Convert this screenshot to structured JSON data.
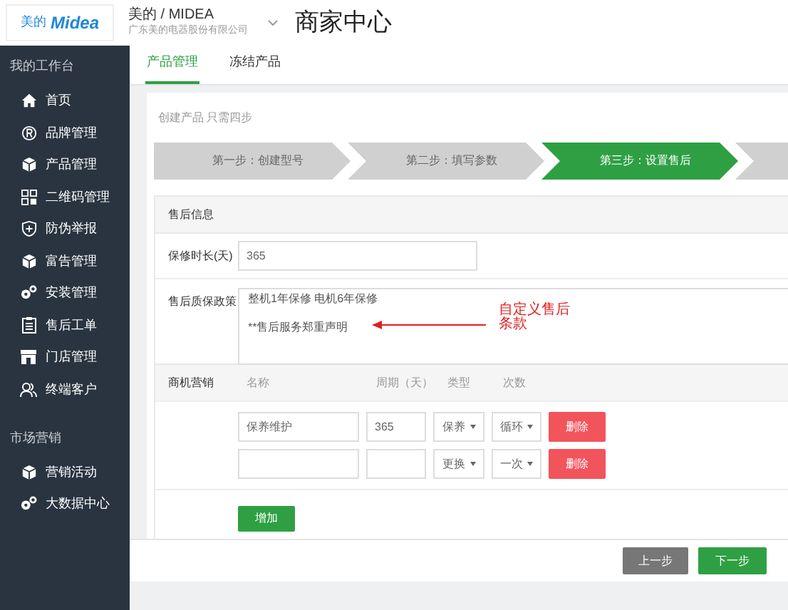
{
  "header": {
    "logo_cn": "美的",
    "logo": "Midea",
    "brand": "美的 / MIDEA",
    "company": "广东美的电器股份有限公司",
    "title": "商家中心"
  },
  "sidebar": {
    "sections": [
      {
        "title": "我的工作台",
        "items": [
          {
            "label": "首页"
          },
          {
            "label": "品牌管理"
          },
          {
            "label": "产品管理"
          },
          {
            "label": "二维码管理"
          },
          {
            "label": "防伪举报"
          },
          {
            "label": "富告管理"
          },
          {
            "label": "安装管理"
          },
          {
            "label": "售后工单"
          },
          {
            "label": "门店管理"
          },
          {
            "label": "终端客户"
          }
        ]
      },
      {
        "title": "市场营销",
        "items": [
          {
            "label": "营销活动"
          },
          {
            "label": "大数据中心"
          }
        ]
      }
    ]
  },
  "tabs": [
    {
      "label": "产品管理",
      "selected": true
    },
    {
      "label": "冻结产品",
      "selected": false
    }
  ],
  "intro": "创建产品 只需四步",
  "steps": [
    {
      "label": "第一步：创建型号",
      "selected": false
    },
    {
      "label": "第二步：填写参数",
      "selected": false
    },
    {
      "label": "第三步：设置售后",
      "selected": true
    },
    {
      "selected": false
    }
  ],
  "section_title": "售后信息",
  "warranty": {
    "label": "保修时长(天)",
    "value": "365"
  },
  "policy": {
    "label": "售后质保政策",
    "value": "整机1年保修 电机6年保修\n\n**售后服务郑重声明"
  },
  "annotation": [
    "自定义售后",
    "条款"
  ],
  "marketing": {
    "label": "商机营销",
    "columns": [
      "名称",
      "周期（天）",
      "类型",
      "次数"
    ],
    "rows": [
      {
        "name": "保养维护",
        "period": "365",
        "type": "保养",
        "count": "循环",
        "delete": "删除"
      },
      {
        "type": "更换",
        "count": "一次",
        "delete": "删除"
      }
    ],
    "add": "增加"
  },
  "footer": {
    "prev": "上一步",
    "next": "下一步"
  }
}
